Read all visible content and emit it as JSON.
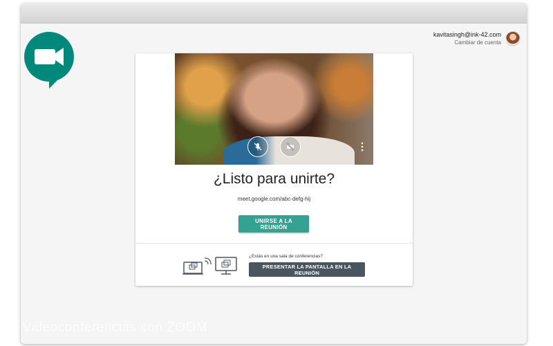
{
  "account": {
    "email": "kavitasingh@ink-42.com",
    "switch_label": "Cambiar de cuenta"
  },
  "icons": {
    "logo": "google-meet-logo-icon",
    "mic": "mic-off-icon",
    "camera": "camera-off-icon",
    "more": "more-vert-icon",
    "present": "cast-screen-icon"
  },
  "main": {
    "title": "¿Listo para unirte?",
    "meeting_link": "meet.google.com/abc-defg-hij",
    "join_label": "UNIRSE A LA REUNIÓN"
  },
  "present": {
    "question": "¿Estás en una sala de conferencias?",
    "button_label": "PRESENTAR LA PANTALLA EN LA REUNIÓN"
  },
  "watermark": "Videoconferencias con ZOOM",
  "colors": {
    "join_button": "#34a191",
    "present_button": "#4b5560",
    "logo_green": "#00897b"
  }
}
